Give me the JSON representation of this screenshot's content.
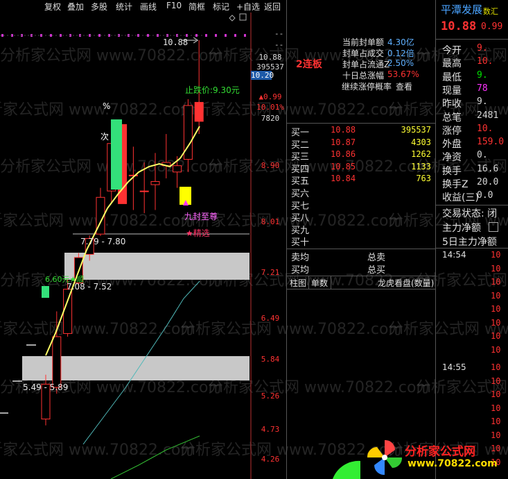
{
  "toolbar": {
    "items": [
      "复权",
      "叠加",
      "多股",
      "统计",
      "画线",
      "F10",
      "简框",
      "标记",
      "+自选",
      "返回"
    ]
  },
  "chart": {
    "top_right_price": "10.88",
    "top_dashes": [
      "--",
      "--"
    ],
    "right_axis": {
      "info_lines": [
        {
          "text": "10.88",
          "color": "#d8d8d8"
        },
        {
          "text": "395537",
          "color": "#d8d8d8"
        },
        {
          "text": "10.20",
          "color": "#ffffff",
          "bg": "#1e5aa8"
        },
        {
          "text": "▲0.99",
          "color": "#ff3232"
        },
        {
          "text": "10.01%",
          "color": "#ff3232"
        },
        {
          "text": "7820",
          "color": "#d8d8d8"
        }
      ],
      "ticks": [
        "8.90",
        "8.01",
        "7.21",
        "6.49",
        "5.84",
        "5.26",
        "4.73",
        "4.26"
      ]
    },
    "chart_data": {
      "type": "candlestick",
      "candles": [
        {
          "open": 4.9,
          "high": 5.6,
          "low": 4.8,
          "close": 5.45
        },
        {
          "open": 5.4,
          "high": 6.6,
          "low": 5.3,
          "close": 6.2
        },
        {
          "open": 6.25,
          "high": 7.1,
          "low": 6.2,
          "close": 6.95
        },
        {
          "open": 7.05,
          "high": 7.52,
          "low": 6.95,
          "close": 7.45
        },
        {
          "open": 7.5,
          "high": 7.8,
          "low": 7.4,
          "close": 7.75
        },
        {
          "open": 7.82,
          "high": 8.55,
          "low": 7.79,
          "close": 8.4
        },
        {
          "open": 8.5,
          "high": 9.45,
          "low": 8.3,
          "close": 9.25
        },
        {
          "open": 9.55,
          "high": 9.55,
          "low": 8.3,
          "close": 8.3
        },
        {
          "open": 8.75,
          "high": 9.2,
          "low": 8.2,
          "close": 8.75
        },
        {
          "open": 8.5,
          "high": 8.95,
          "low": 8.15,
          "close": 8.5
        },
        {
          "open": 8.6,
          "high": 9.1,
          "low": 8.2,
          "close": 8.65
        },
        {
          "open": 8.9,
          "high": 9.4,
          "low": 8.7,
          "close": 8.95
        },
        {
          "open": 8.8,
          "high": 9.05,
          "low": 8.55,
          "close": 8.9
        },
        {
          "open": 9.0,
          "high": 9.95,
          "low": 8.8,
          "close": 9.85
        },
        {
          "open": 9.9,
          "high": 10.88,
          "low": 9.4,
          "close": 9.6
        }
      ],
      "annotations": {
        "stop_price": "止跌价:9.30元",
        "percent_mark": "%",
        "ci_mark": "次",
        "nine_seal": "九封至尊",
        "selected": "★精选",
        "zone_upper": "7.79 - 7.80",
        "zone_middle": "7.08 - 7.52",
        "zone_lower": "5.49 - 5.89",
        "buy_mark": "6.60元★顺"
      }
    }
  },
  "middle_panel": {
    "limit_board": "2连板",
    "stats": [
      {
        "label": "当前封单额",
        "value": "4.30亿"
      },
      {
        "label": "封单占成交",
        "value": "0.12倍"
      },
      {
        "label": "封单占流通Z",
        "value": "2.50%"
      },
      {
        "label": "十日总涨幅",
        "value": "53.67%"
      },
      {
        "label": "继续涨停概率",
        "value": "查看"
      }
    ],
    "orderbook": [
      {
        "label": "买一",
        "price": "10.88",
        "vol": "395537"
      },
      {
        "label": "买二",
        "price": "10.87",
        "vol": "4303"
      },
      {
        "label": "买三",
        "price": "10.86",
        "vol": "1262"
      },
      {
        "label": "买四",
        "price": "10.85",
        "vol": "1133"
      },
      {
        "label": "买五",
        "price": "10.84",
        "vol": "763"
      },
      {
        "label": "买六",
        "price": "",
        "vol": ""
      },
      {
        "label": "买七",
        "price": "",
        "vol": ""
      },
      {
        "label": "买八",
        "price": "",
        "vol": ""
      },
      {
        "label": "买九",
        "price": "",
        "vol": ""
      },
      {
        "label": "买十",
        "price": "",
        "vol": ""
      }
    ],
    "avg_rows": [
      {
        "left": "卖均",
        "right": "总卖"
      },
      {
        "left": "买均",
        "right": "总买"
      }
    ],
    "tabs": [
      "柱图",
      "单数",
      "龙虎看盘(数量)"
    ]
  },
  "quote_panel": {
    "stock_name": "平潭发展",
    "price_tag": "数汇",
    "price": "10.88",
    "change": "0.99",
    "rows": [
      {
        "label": "今开",
        "value": "9.",
        "color": "#ff3232"
      },
      {
        "label": "最高",
        "value": "10.",
        "color": "#ff3232"
      },
      {
        "label": "最低",
        "value": "9.",
        "color": "#00e000"
      },
      {
        "label": "现量",
        "value": "78",
        "color": "#ff33ff"
      },
      {
        "label": "昨收",
        "value": "9.",
        "color": "#d8d8d8"
      },
      {
        "label": "总笔",
        "value": "2481",
        "color": "#d8d8d8"
      },
      {
        "label": "涨停",
        "value": "10.",
        "color": "#ff3232"
      },
      {
        "label": "外盘",
        "value": "159.0",
        "color": "#ff3232"
      },
      {
        "label": "净资",
        "value": "0.",
        "color": "#d8d8d8"
      },
      {
        "label": "换手",
        "value": "16.6",
        "color": "#d8d8d8"
      },
      {
        "label": "换手Z",
        "value": "20.0",
        "color": "#d8d8d8"
      },
      {
        "label": "收益(三)",
        "value": "0.0",
        "color": "#d8d8d8"
      }
    ],
    "status_label": "交易状态: 闭",
    "main_net": "主力净额",
    "main_net5": "5日主力净额",
    "ticks": [
      {
        "time": "14:54",
        "prices": [
          "10",
          "10",
          "10",
          "10",
          "10",
          "10",
          "10",
          "10"
        ]
      },
      {
        "time": "14:55",
        "prices": [
          "10",
          "10",
          "10",
          "10",
          "10",
          "10",
          "10",
          "10"
        ]
      }
    ]
  },
  "logo": {
    "title": "分析家公式网",
    "url": "www.70822.com"
  },
  "watermark": "分析家公式网 www.70822.com"
}
